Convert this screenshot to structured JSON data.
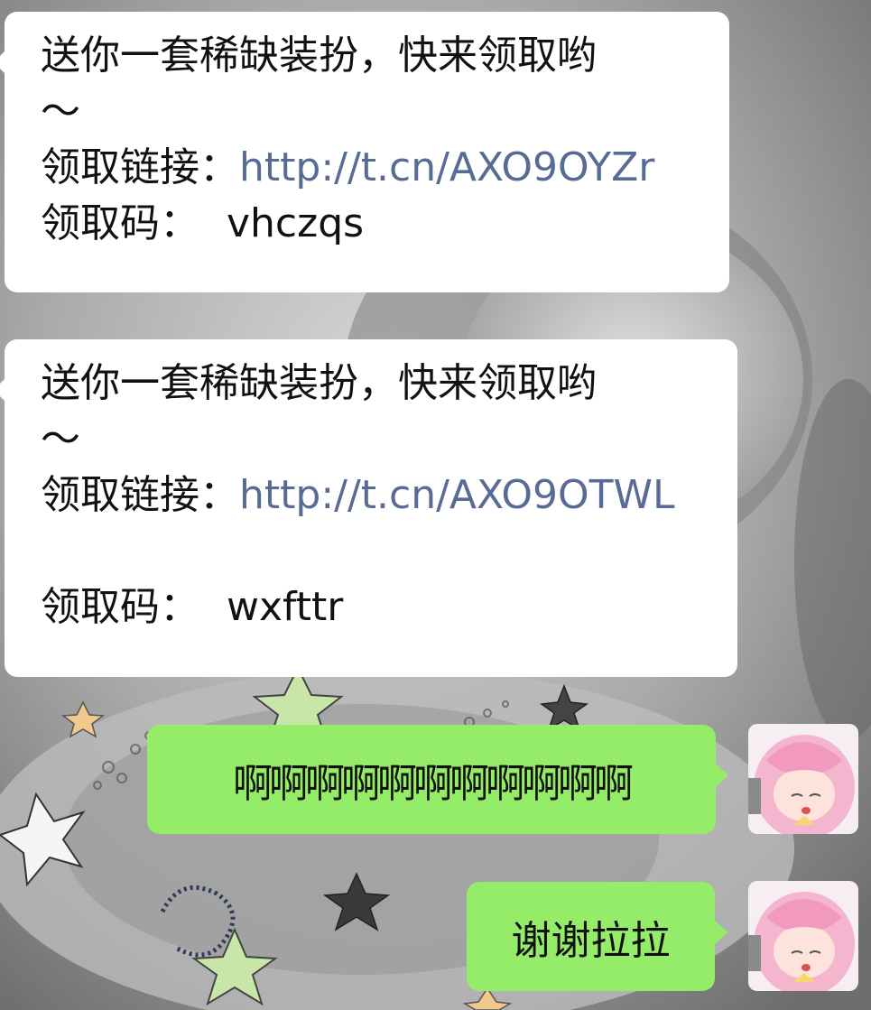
{
  "messages": [
    {
      "direction": "incoming",
      "line1": "送你一套稀缺装扮，快来领取哟",
      "line2": "～",
      "link_label": "领取链接：",
      "link_url": "http://t.cn/AXO9OYZr",
      "code_label": "领取码：",
      "code_value": "vhczqs"
    },
    {
      "direction": "incoming",
      "line1": "送你一套稀缺装扮，快来领取哟",
      "line2": "～",
      "link_label": "领取链接：",
      "link_url": "http://t.cn/AXO9OTWL",
      "code_label": "领取码：",
      "code_value": "wxfttr"
    },
    {
      "direction": "outgoing",
      "text": "啊啊啊啊啊啊啊啊啊啊啊",
      "avatar": "anime-girl-avatar"
    },
    {
      "direction": "outgoing",
      "text": "谢谢拉拉",
      "avatar": "anime-girl-avatar"
    }
  ],
  "colors": {
    "incoming_bubble": "#ffffff",
    "outgoing_bubble": "#95ec69",
    "link": "#576b95",
    "text": "#111111"
  }
}
